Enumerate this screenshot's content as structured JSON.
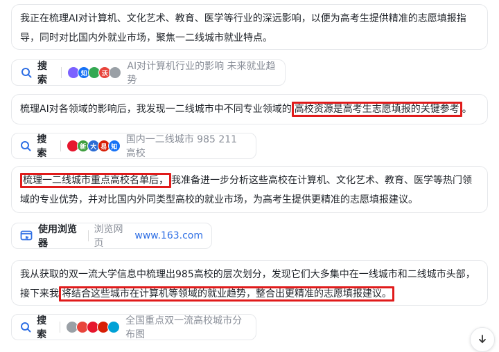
{
  "blocks": {
    "b1_text": "我正在梳理AI对计算机、文化艺术、教育、医学等行业的深远影响，以便为高考生提供精准的志愿填报指导，同时对比国内外就业市场，聚焦一二线城市就业特点。",
    "b2_pre": "梳理AI对各领域的影响后，我发现一二线城市中不同专业领域的",
    "b2_hl": "高校资源是高考生志愿填报的关键参考",
    "b2_post": "。",
    "b3_hl": "梳理一二线城市重点高校名单后，",
    "b3_post": "我准备进一步分析这些高校在计算机、文化艺术、教育、医学等热门领域的专业优势，并对比国内外同类型高校的就业市场，为高考生提供更精准的志愿填报建议。",
    "b4_pre": "我从获取的双一流大学信息中梳理出985高校的层次划分，发现它们大多集中在一线城市和二线城市头部，接下来我",
    "b4_hl": "将结合这些城市在计算机等领域的就业趋势，整合出更精准的志愿填报建议。",
    "b4_post": ""
  },
  "chips": {
    "search_label": "搜索",
    "s1_query": "AI对计算机行业的影响 未来就业趋势",
    "s2_query": "国内一二线城市 985 211 高校",
    "browser_label": "使用浏览器",
    "browser_action": "浏览网页",
    "browser_url": "www.163.com",
    "s3_query": "全国重点双一流高校城市分布图"
  },
  "favicons": {
    "s1": [
      {
        "t": "",
        "c": "#7b61ff"
      },
      {
        "t": "知",
        "c": "#1772f6"
      },
      {
        "t": "",
        "c": "#34a853"
      },
      {
        "t": "沃",
        "c": "#e8453c"
      },
      {
        "t": "",
        "c": "#9aa0a6"
      }
    ],
    "s2": [
      {
        "t": "",
        "c": "#e6162d"
      },
      {
        "t": "新",
        "c": "#3f9e3f"
      },
      {
        "t": "大",
        "c": "#2b6cd4"
      },
      {
        "t": "易",
        "c": "#d81e06"
      },
      {
        "t": "知",
        "c": "#1772f6"
      }
    ],
    "s3": [
      {
        "t": "",
        "c": "#9aa0a6"
      },
      {
        "t": "",
        "c": "#e8453c"
      },
      {
        "t": "",
        "c": "#e6162d"
      },
      {
        "t": "",
        "c": "#d81e06"
      },
      {
        "t": "",
        "c": "#00a1d6"
      }
    ]
  },
  "colors": {
    "highlight": "#e01b1b",
    "link": "#2f6fe4",
    "accent": "#2f6fe4"
  }
}
